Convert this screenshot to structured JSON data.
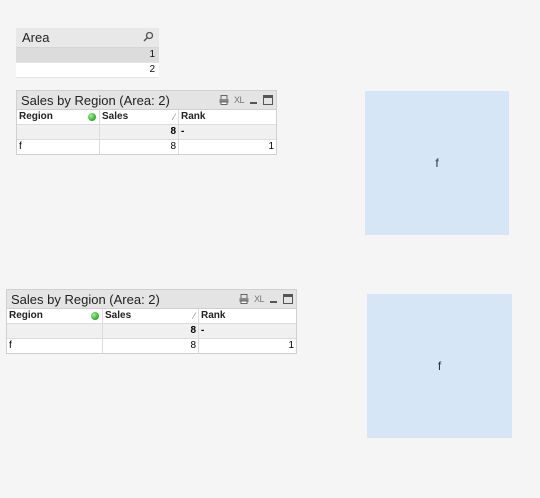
{
  "listbox": {
    "title": "Area",
    "values": [
      "1",
      "2"
    ]
  },
  "table1": {
    "title": "Sales by Region (Area: 2)",
    "xl_label": "XL",
    "headers": [
      "Region",
      "Sales",
      "Rank"
    ],
    "total": {
      "sales": "8",
      "rank": "-"
    },
    "row": {
      "region": "f",
      "sales": "8",
      "rank": "1"
    }
  },
  "table2": {
    "title": "Sales by Region (Area: 2)",
    "xl_label": "XL",
    "headers": [
      "Region",
      "Sales",
      "Rank"
    ],
    "total": {
      "sales": "8",
      "rank": "-"
    },
    "row": {
      "region": "f",
      "sales": "8",
      "rank": "1"
    }
  },
  "textbox1": {
    "text": "f"
  },
  "textbox2": {
    "text": "f"
  },
  "colors": {
    "textbox_bg": "#d6e6f7",
    "caption_bg": "#e4e4e4",
    "background": "#f5f5f5"
  }
}
